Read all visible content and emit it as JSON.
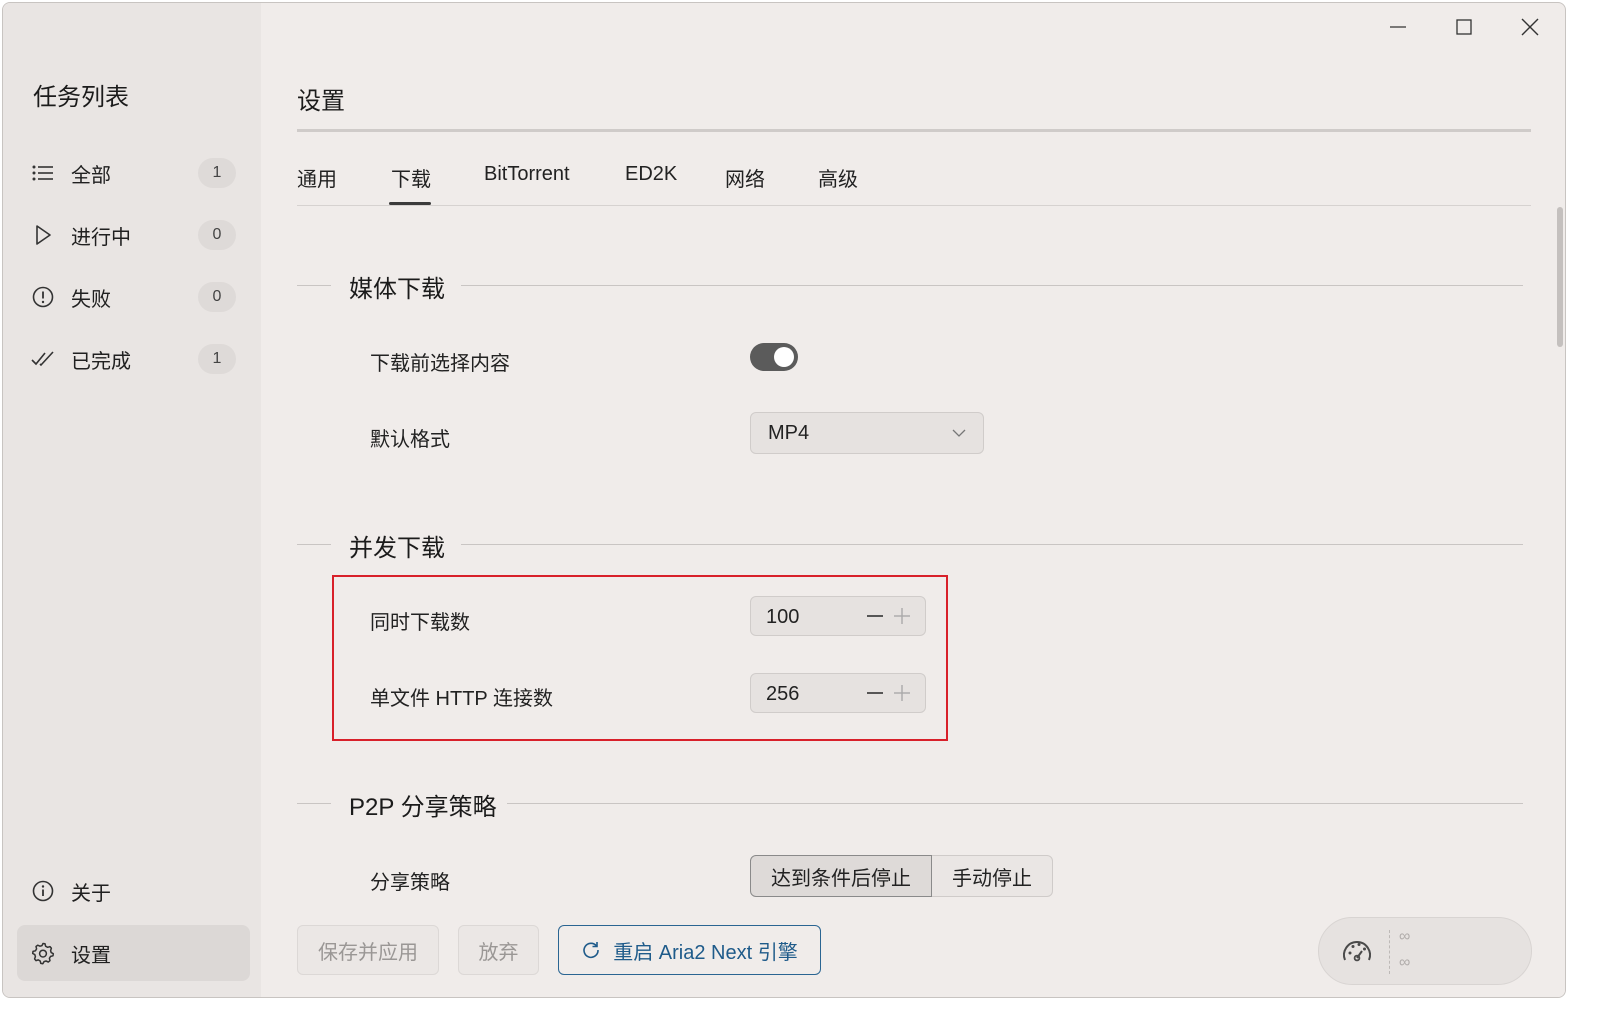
{
  "sidebar": {
    "title": "任务列表",
    "items": [
      {
        "label": "全部",
        "count": "1"
      },
      {
        "label": "进行中",
        "count": "0"
      },
      {
        "label": "失败",
        "count": "0"
      },
      {
        "label": "已完成",
        "count": "1"
      }
    ],
    "bottom": [
      {
        "label": "关于"
      },
      {
        "label": "设置"
      }
    ]
  },
  "page": {
    "title": "设置"
  },
  "tabs": [
    "通用",
    "下载",
    "BitTorrent",
    "ED2K",
    "网络",
    "高级"
  ],
  "active_tab": "下载",
  "sections": {
    "media": {
      "title": "媒体下载",
      "select_before_label": "下载前选择内容",
      "select_before_on": true,
      "default_format_label": "默认格式",
      "default_format_value": "MP4"
    },
    "concurrency": {
      "title": "并发下载",
      "max_downloads_label": "同时下载数",
      "max_downloads_value": "100",
      "http_conn_label": "单文件 HTTP 连接数",
      "http_conn_value": "256"
    },
    "p2p": {
      "title": "P2P 分享策略",
      "strategy_label": "分享策略",
      "options": [
        "达到条件后停止",
        "手动停止"
      ],
      "selected": "达到条件后停止"
    }
  },
  "footer": {
    "save": "保存并应用",
    "discard": "放弃",
    "restart": "重启 Aria2 Next 引擎",
    "speed_up": "∞",
    "speed_down": "∞"
  },
  "colors": {
    "highlight": "#d8202a",
    "primary": "#1f5b8a",
    "toggle": "#5b5b5b"
  }
}
